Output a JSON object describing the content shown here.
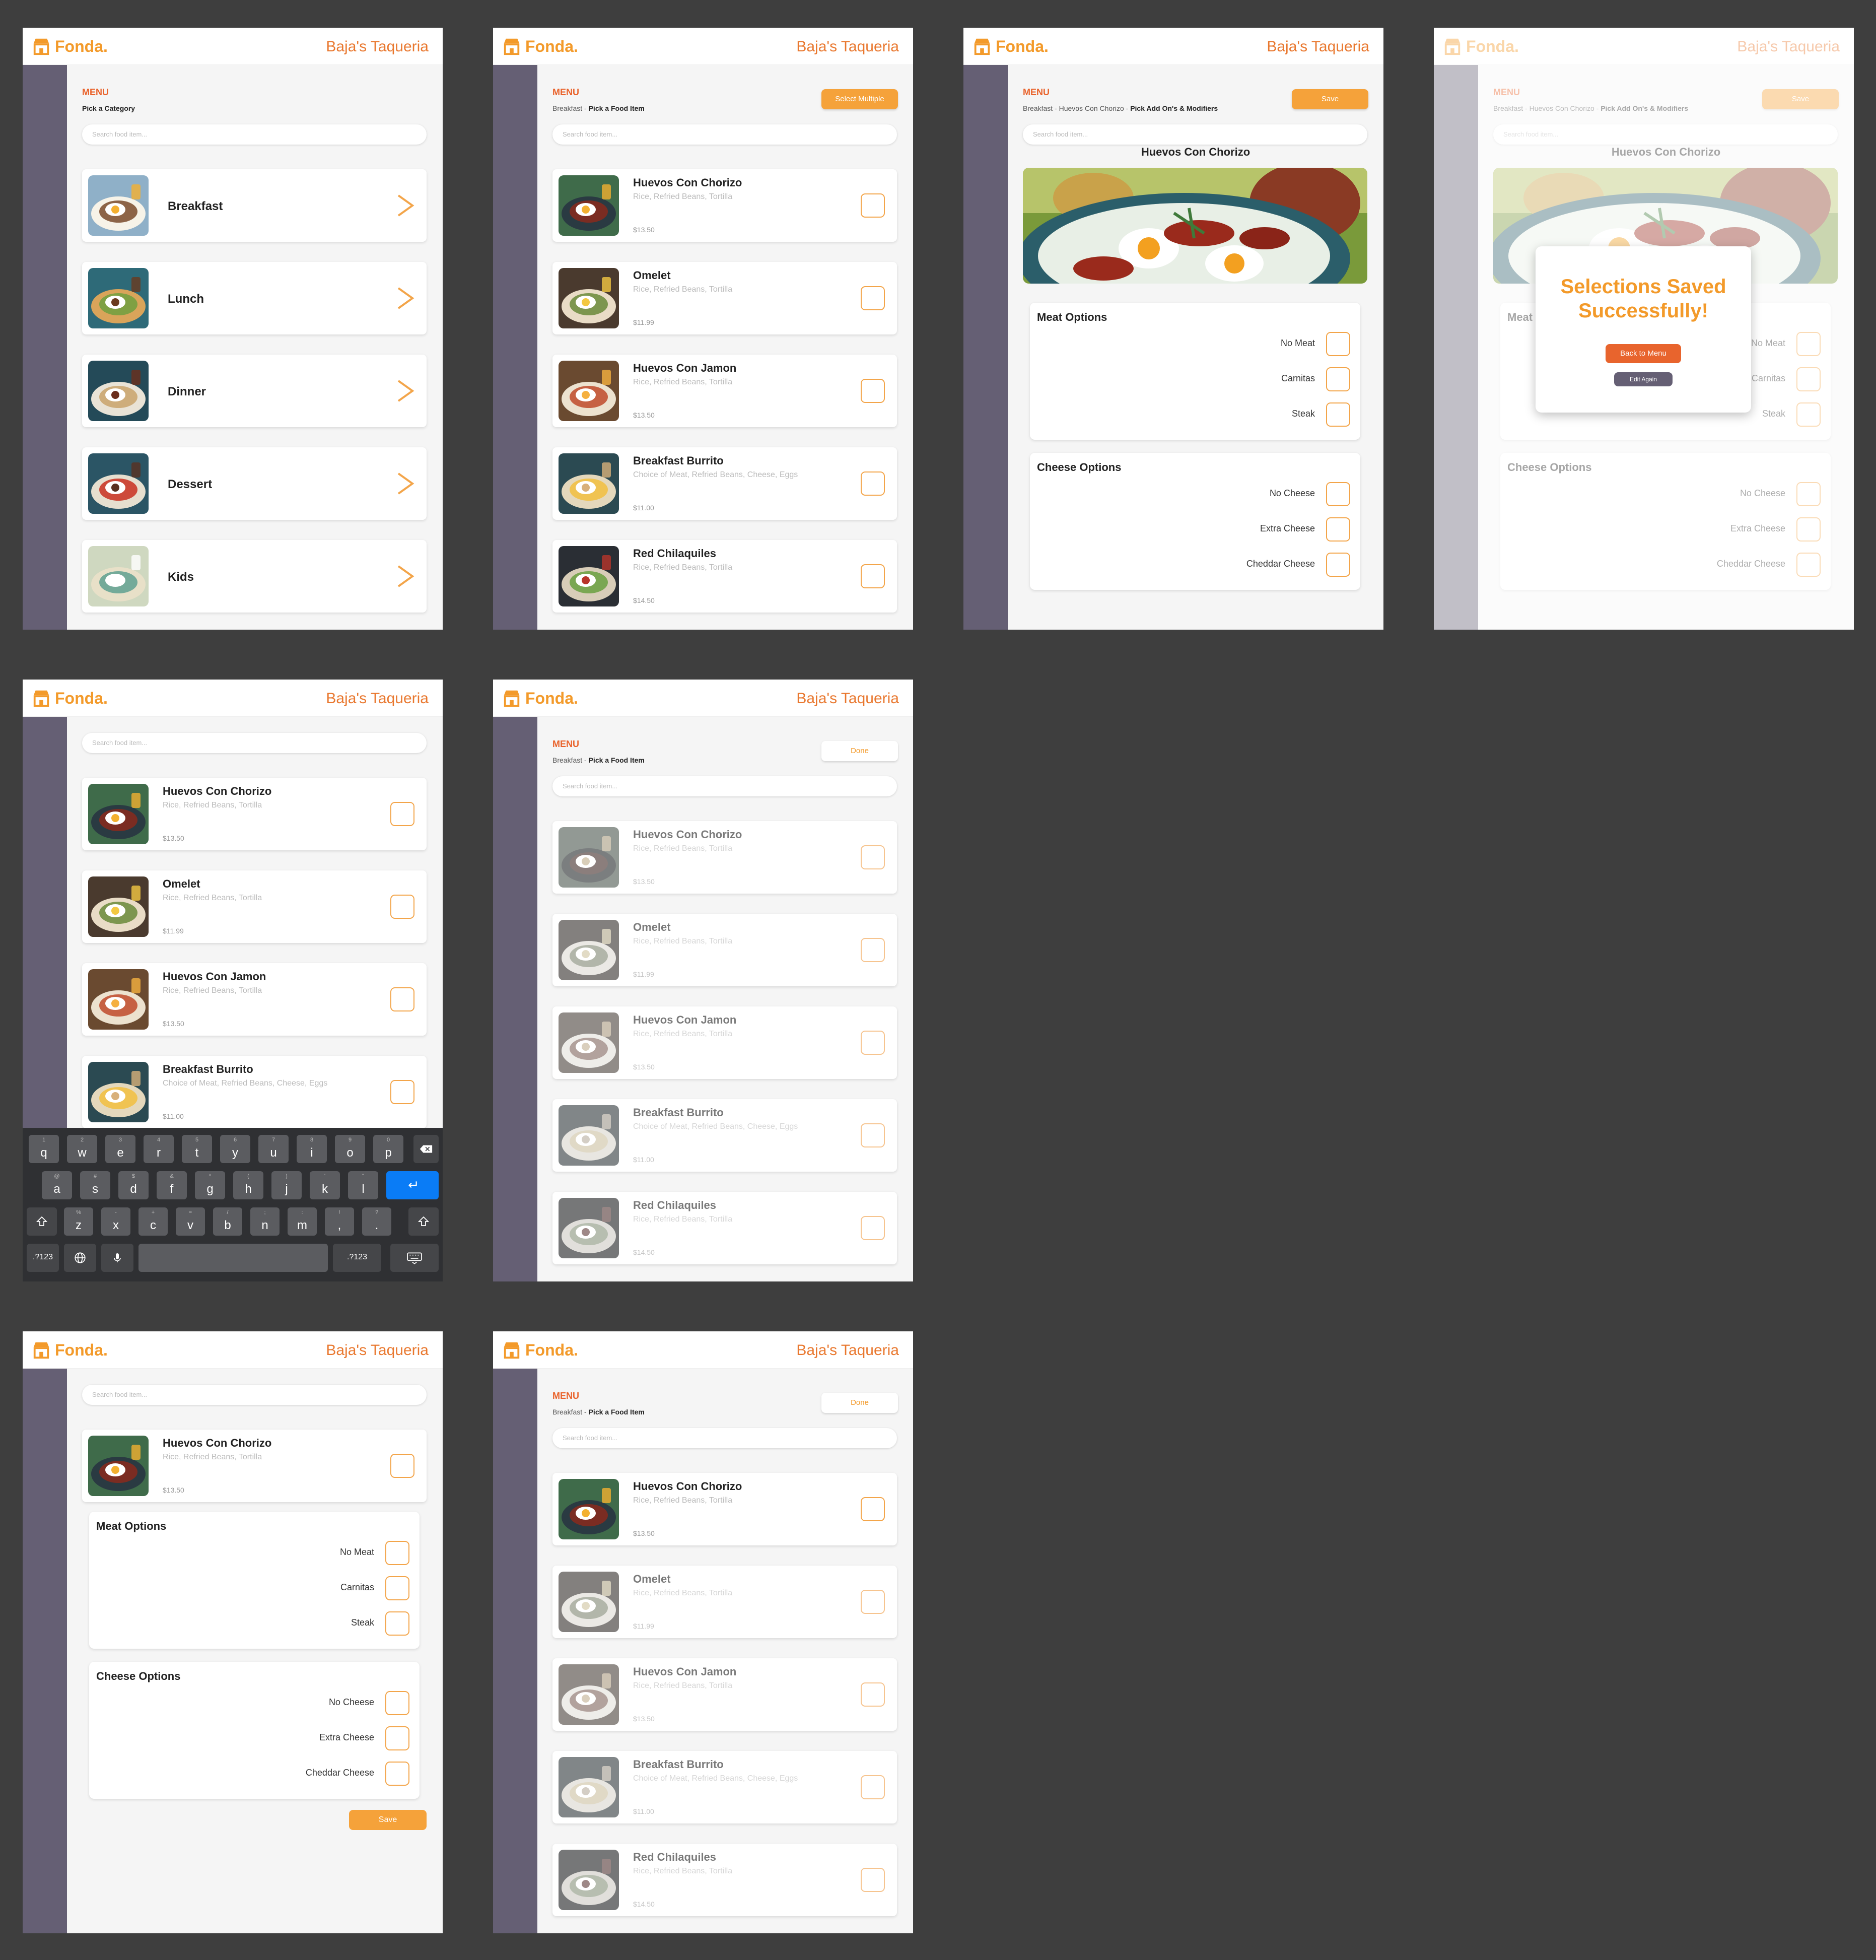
{
  "brand": {
    "logo": "Fonda.",
    "restaurant": "Baja's Taqueria",
    "accent": "#f39a2a",
    "sidebar": "#655f74",
    "background": "#3e3e3e"
  },
  "common": {
    "menu": "MENU",
    "search_placeholder": "Search food item..."
  },
  "categories_screen": {
    "crumb": "Pick a Category",
    "categories": [
      {
        "label": "Breakfast",
        "icon": "chevron-right-icon"
      },
      {
        "label": "Lunch",
        "icon": "chevron-right-icon"
      },
      {
        "label": "Dinner",
        "icon": "chevron-right-icon"
      },
      {
        "label": "Dessert",
        "icon": "chevron-right-icon"
      },
      {
        "label": "Kids",
        "icon": "chevron-right-icon"
      }
    ]
  },
  "items_screen": {
    "crumb_prefix": "Breakfast - ",
    "crumb_current": "Pick a Food Item",
    "select_multiple": "Select Multiple",
    "done": "Done"
  },
  "items": [
    {
      "name": "Huevos Con Chorizo",
      "desc": "Rice, Refried Beans, Tortilla",
      "price": "$13.50"
    },
    {
      "name": "Omelet",
      "desc": "Rice, Refried Beans, Tortilla",
      "price": "$11.99"
    },
    {
      "name": "Huevos Con Jamon",
      "desc": "Rice, Refried Beans, Tortilla",
      "price": "$13.50"
    },
    {
      "name": "Breakfast Burrito",
      "desc": "Choice of Meat, Refried Beans, Cheese, Eggs",
      "price": "$11.00"
    },
    {
      "name": "Red Chilaquiles",
      "desc": "Rice, Refried Beans, Tortilla",
      "price": "$14.50"
    }
  ],
  "modifiers_screen": {
    "crumb_prefix": "Breakfast - Huevos Con Chorizo - ",
    "crumb_current": "Pick Add On's & Modifiers",
    "save": "Save",
    "dish": "Huevos Con Chorizo",
    "meat_title": "Meat Options",
    "meat": [
      "No Meat",
      "Carnitas",
      "Steak"
    ],
    "cheese_title": "Cheese Options",
    "cheese": [
      "No Cheese",
      "Extra Cheese",
      "Cheddar Cheese"
    ]
  },
  "modal": {
    "title": "Selections Saved Successfully!",
    "back": "Back to Menu",
    "edit": "Edit Again"
  },
  "keyboard": {
    "row1": [
      [
        "1",
        "q"
      ],
      [
        "2",
        "w"
      ],
      [
        "3",
        "e"
      ],
      [
        "4",
        "r"
      ],
      [
        "5",
        "t"
      ],
      [
        "6",
        "y"
      ],
      [
        "7",
        "u"
      ],
      [
        "8",
        "i"
      ],
      [
        "9",
        "o"
      ],
      [
        "0",
        "p"
      ]
    ],
    "row2": [
      [
        "@",
        "a"
      ],
      [
        "#",
        "s"
      ],
      [
        "$",
        "d"
      ],
      [
        "&",
        "f"
      ],
      [
        "*",
        "g"
      ],
      [
        "(",
        "h"
      ],
      [
        ")",
        "j"
      ],
      [
        "'",
        "k"
      ],
      [
        "\"",
        "l"
      ]
    ],
    "row3": [
      [
        "%",
        "z"
      ],
      [
        "-",
        "x"
      ],
      [
        "+",
        "c"
      ],
      [
        "=",
        "v"
      ],
      [
        "/",
        "b"
      ],
      [
        ";",
        "n"
      ],
      [
        ":",
        "m"
      ],
      [
        "!",
        ","
      ],
      [
        "?",
        "."
      ]
    ],
    "numbers": ".?123"
  }
}
